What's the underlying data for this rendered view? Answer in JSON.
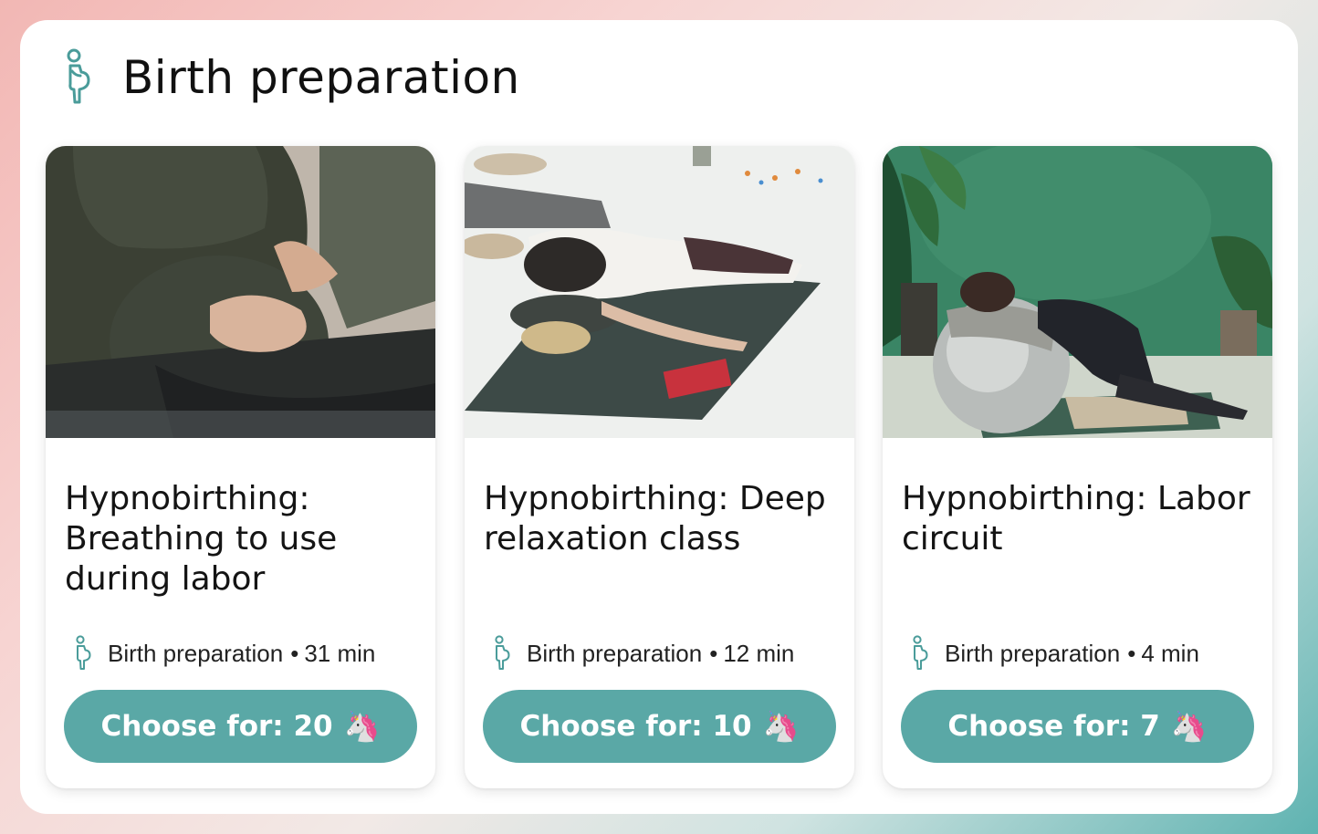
{
  "section": {
    "title": "Birth preparation",
    "icon": "pregnant-person-icon"
  },
  "colors": {
    "accent": "#5aa8a6",
    "icon_stroke": "#4a9c9a"
  },
  "cards": [
    {
      "title": "Hypnobirthing: Breathing to use during labor",
      "category": "Birth preparation",
      "separator": "•",
      "duration": "31 min",
      "button_label": "Choose for: 20",
      "button_icon": "🦄",
      "image": "pregnant-woman-holding-belly-photo"
    },
    {
      "title": "Hypnobirthing: Deep relaxation class",
      "category": "Birth preparation",
      "separator": "•",
      "duration": "12 min",
      "button_label": "Choose for: 10",
      "button_icon": "🦄",
      "image": "woman-relaxing-on-yoga-bolster-photo"
    },
    {
      "title": "Hypnobirthing: Labor circuit",
      "category": "Birth preparation",
      "separator": "•",
      "duration": "4 min",
      "button_label": "Choose for: 7",
      "button_icon": "🦄",
      "image": "woman-leaning-on-birth-ball-photo"
    }
  ]
}
